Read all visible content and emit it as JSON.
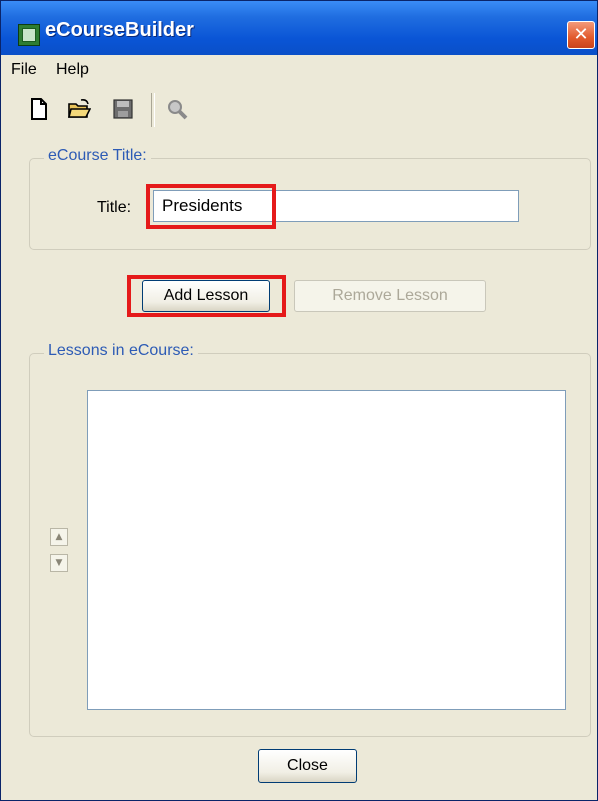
{
  "window": {
    "title": "eCourseBuilder",
    "close_glyph": "✕"
  },
  "menu": {
    "items": [
      "File",
      "Help"
    ]
  },
  "toolbar": {
    "icons": [
      "new-document-icon",
      "open-folder-icon",
      "save-icon",
      "search-icon"
    ]
  },
  "course_title_group": {
    "label": "eCourse Title:",
    "field_label": "Title:",
    "field_value": "Presidents"
  },
  "buttons": {
    "add_lesson": "Add Lesson",
    "remove_lesson": "Remove Lesson",
    "close": "Close"
  },
  "lessons_group": {
    "label": "Lessons in eCourse:",
    "items": [],
    "move_up_glyph": "▲",
    "move_down_glyph": "▼"
  },
  "colors": {
    "highlight": "#e51a1a",
    "group_label": "#2d5bb5",
    "titlebar": "#0a55d6",
    "window_bg": "#ece9d8"
  }
}
